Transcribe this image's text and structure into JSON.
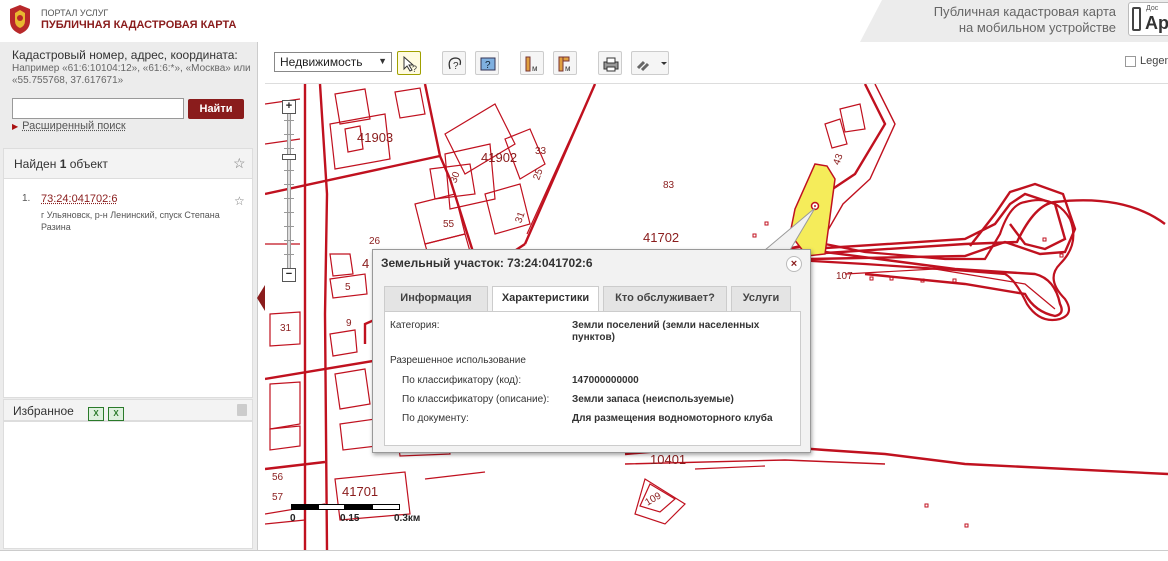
{
  "header": {
    "portal_small": "ПОРТАЛ УСЛУГ",
    "portal_title": "ПУБЛИЧНАЯ КАДАСТРОВАЯ КАРТА",
    "mobile_line1": "Публичная кадастровая карта",
    "mobile_line2": "на мобильном устройстве",
    "app_small": "Дос",
    "app_big": "Ap"
  },
  "search": {
    "label": "Кадастровый номер, адрес, координата:",
    "example": "Например «61:6:10104:12», «61:6:*», «Москва» или «55.755768, 37.617671»",
    "value": "",
    "button": "Найти",
    "advanced": "Расширенный поиск"
  },
  "results": {
    "title_prefix": "Найден ",
    "count": "1",
    "title_suffix": " объект",
    "items": [
      {
        "num": "1.",
        "link": "73:24:041702:6",
        "address": "г Ульяновск, р-н Ленинский, спуск Степана Разина"
      }
    ]
  },
  "favorites": {
    "title": "Избранное"
  },
  "toolbar": {
    "select_value": "Недвижимость",
    "legend": "Legen"
  },
  "map": {
    "labels": {
      "l41903": "41903",
      "l41902": "41902",
      "l41702": "41702",
      "l41701": "41701",
      "l10401": "10401",
      "l83": "83",
      "l43": "43",
      "l107": "107",
      "l109": "109",
      "l33": "33",
      "l25": "25",
      "l30": "30",
      "l31a": "31",
      "l55": "55",
      "l26": "26",
      "l4": "4",
      "l5": "5",
      "l9": "9",
      "l31b": "31",
      "l56": "56",
      "l57": "57"
    },
    "scale": {
      "s0": "0",
      "s1": "0.15",
      "s2": "0.3км"
    }
  },
  "popup": {
    "title": "Земельный участок: 73:24:041702:6",
    "tabs": [
      "Информация",
      "Характеристики",
      "Кто обслуживает?",
      "Услуги"
    ],
    "active_tab": "Характеристики",
    "category_label": "Категория:",
    "category_value": "Земли поселений (земли населенных пунктов)",
    "use_label": "Разрешенное использование",
    "rows": [
      {
        "label": "По классификатору (код):",
        "value": "147000000000"
      },
      {
        "label": "По классификатору (описание):",
        "value": "Земли запаса (неиспользуемые)"
      },
      {
        "label": "По документу:",
        "value": "Для размещения водномоторного клуба"
      }
    ]
  },
  "colors": {
    "brand": "#8a1c1c",
    "map_line": "#c0111f",
    "parcel_highlight": "#f5ec5a"
  }
}
